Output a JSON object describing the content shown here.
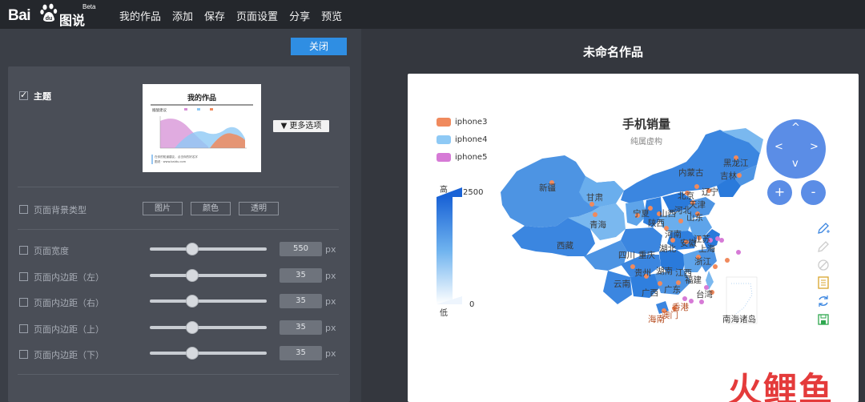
{
  "app": {
    "logo_text": "Bai",
    "logo_suffix": "图说",
    "beta": "Beta"
  },
  "nav": {
    "items": [
      "我的作品",
      "添加",
      "保存",
      "页面设置",
      "分享",
      "预览"
    ]
  },
  "panel": {
    "close_label": "关闭",
    "theme_label": "主题",
    "more_options_label": "▼ 更多选项",
    "thumbnail": {
      "title": "我的作品",
      "subtitle": "搬酸建议",
      "footer_line1": "在你的知道建议，点击你的好名字",
      "footer_line2": "图说 · www.baidu.com"
    },
    "bg_type_label": "页面背景类型",
    "bg_buttons": [
      "图片",
      "颜色",
      "透明"
    ],
    "settings": [
      {
        "label": "页面宽度",
        "value": "550",
        "unit": "px"
      },
      {
        "label": "页面内边距（左）",
        "value": "35",
        "unit": "px"
      },
      {
        "label": "页面内边距（右）",
        "value": "35",
        "unit": "px"
      },
      {
        "label": "页面内边距（上）",
        "value": "35",
        "unit": "px"
      },
      {
        "label": "页面内边距（下）",
        "value": "35",
        "unit": "px"
      }
    ]
  },
  "preview": {
    "work_title": "未命名作品"
  },
  "chart_data": {
    "type": "map",
    "title": "手机销量",
    "subtitle": "纯属虚构",
    "legend": [
      {
        "name": "iphone3",
        "color": "#f08a5d"
      },
      {
        "name": "iphone4",
        "color": "#8ec9f5"
      },
      {
        "name": "iphone5",
        "color": "#d67ad6"
      }
    ],
    "visual_map": {
      "high_label": "高",
      "low_label": "低",
      "max": "2500",
      "min": "0"
    },
    "provinces": [
      "黑龙江",
      "吉林",
      "内蒙古",
      "辽宁",
      "北京",
      "天津",
      "新疆",
      "甘肃",
      "宁夏",
      "山西",
      "河北",
      "山东",
      "青海",
      "陕西",
      "河南",
      "江苏",
      "西藏",
      "安徽",
      "上海",
      "四川",
      "重庆",
      "湖北",
      "浙江",
      "贵州",
      "湖南",
      "江西",
      "福建",
      "云南",
      "广西",
      "广东",
      "台湾",
      "香港",
      "澳门",
      "海南",
      "南海诸岛"
    ]
  },
  "watermark": "火鲤鱼"
}
